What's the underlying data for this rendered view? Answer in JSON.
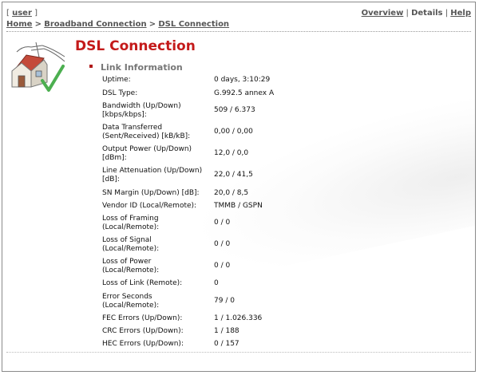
{
  "header": {
    "user_bracket_open": "[",
    "user_link": "user",
    "user_bracket_close": "]",
    "links": {
      "overview": "Overview",
      "sep1": "|",
      "details": "Details",
      "sep2": "|",
      "help": "Help"
    },
    "breadcrumb": {
      "home": "Home",
      "gt1": ">",
      "broadband": "Broadband Connection",
      "gt2": ">",
      "dsl": "DSL Connection"
    }
  },
  "page": {
    "title": "DSL Connection",
    "section": "Link Information"
  },
  "icon": "house-with-checkmark-icon",
  "colors": {
    "title": "#c41a1a",
    "links": "#555555",
    "bullet": "#b01a1a",
    "check": "#4caf50"
  },
  "rows": [
    {
      "label": "Uptime:",
      "value": "0 days, 3:10:29"
    },
    {
      "label": "DSL Type:",
      "value": "G.992.5 annex A"
    },
    {
      "label": "Bandwidth (Up/Down) [kbps/kbps]:",
      "value": "509 / 6.373"
    },
    {
      "label": "Data Transferred (Sent/Received) [kB/kB]:",
      "value": "0,00 / 0,00"
    },
    {
      "label": "Output Power (Up/Down) [dBm]:",
      "value": "12,0 / 0,0"
    },
    {
      "label": "Line Attenuation (Up/Down) [dB]:",
      "value": "22,0 / 41,5"
    },
    {
      "label": "SN Margin (Up/Down) [dB]:",
      "value": "20,0 / 8,5"
    },
    {
      "label": "Vendor ID (Local/Remote):",
      "value": "TMMB / GSPN"
    },
    {
      "label": "Loss of Framing (Local/Remote):",
      "value": "0 / 0"
    },
    {
      "label": "Loss of Signal (Local/Remote):",
      "value": "0 / 0"
    },
    {
      "label": "Loss of Power (Local/Remote):",
      "value": "0 / 0"
    },
    {
      "label": "Loss of Link (Remote):",
      "value": "0"
    },
    {
      "label": "Error Seconds (Local/Remote):",
      "value": "79 / 0"
    },
    {
      "label": "FEC Errors (Up/Down):",
      "value": "1 / 1.026.336"
    },
    {
      "label": "CRC Errors (Up/Down):",
      "value": "1 / 188"
    },
    {
      "label": "HEC Errors (Up/Down):",
      "value": "0 / 157"
    }
  ]
}
